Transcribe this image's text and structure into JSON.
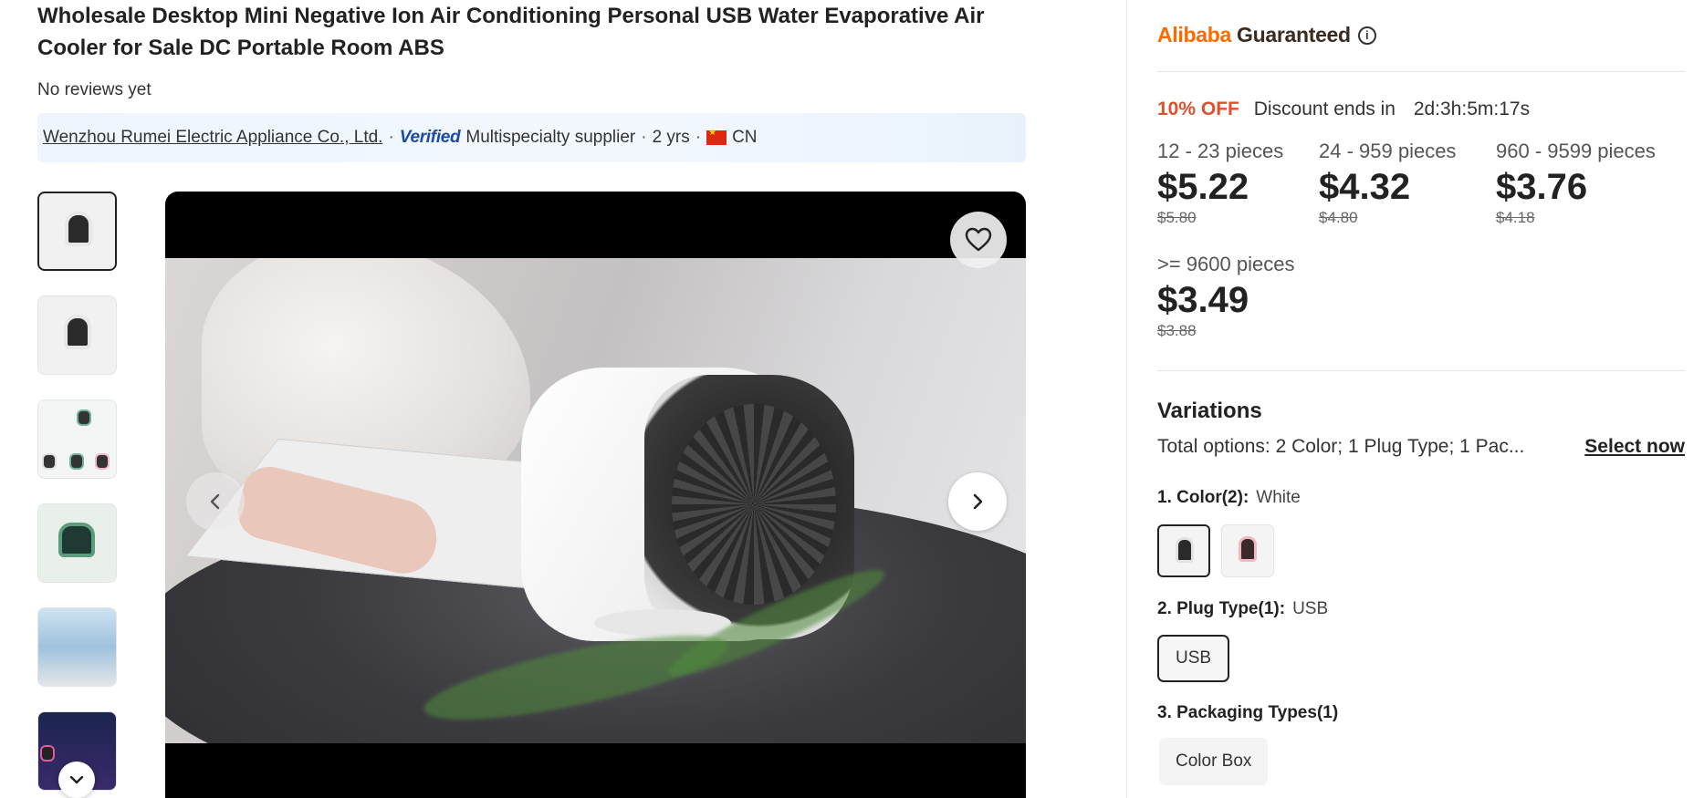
{
  "product": {
    "title": "Wholesale Desktop Mini Negative Ion Air Conditioning Personal USB Water Evaporative Air Cooler for Sale DC Portable Room ABS",
    "reviews": "No reviews yet"
  },
  "supplier": {
    "name": "Wenzhou Rumei Electric Appliance Co., Ltd.",
    "sep1": "·",
    "verified_label": "Verified",
    "type": "Multispecialty supplier",
    "sep2": "·",
    "years": "2 yrs",
    "sep3": "·",
    "country": "CN",
    "country_flag": "china-flag-icon"
  },
  "gallery": {
    "thumbnails": [
      {
        "name": "thumbnail-1",
        "kind": "white-fan",
        "selected": true
      },
      {
        "name": "thumbnail-2",
        "kind": "white-fan"
      },
      {
        "name": "thumbnail-3",
        "kind": "multi-color"
      },
      {
        "name": "thumbnail-4",
        "kind": "green-fan"
      },
      {
        "name": "thumbnail-5",
        "kind": "poster"
      },
      {
        "name": "thumbnail-6",
        "kind": "dark-poster"
      }
    ],
    "icons": {
      "favorite": "heart-icon",
      "prev": "chevron-left-icon",
      "next": "chevron-right-icon",
      "more": "chevron-down-icon"
    }
  },
  "guarantee": {
    "brand": "Alibaba",
    "label": "Guaranteed",
    "info_icon": "ⓘ",
    "brand_color": "#ff6a00"
  },
  "discount": {
    "percent": "10% OFF",
    "label": "Discount ends in",
    "countdown": "2d:3h:5m:17s",
    "color": "#e0502b"
  },
  "price_tiers": [
    {
      "range": "12 - 23 pieces",
      "price": "$5.22",
      "original": "$5.80"
    },
    {
      "range": "24 - 959 pieces",
      "price": "$4.32",
      "original": "$4.80"
    },
    {
      "range": "960 - 9599 pieces",
      "price": "$3.76",
      "original": "$4.18"
    },
    {
      "range": ">= 9600 pieces",
      "price": "$3.49",
      "original": "$3.88"
    }
  ],
  "variations": {
    "title": "Variations",
    "summary": "Total options: 2 Color; 1 Plug Type; 1 Pac...",
    "select_now": "Select now",
    "color": {
      "label": "1. Color(2):",
      "value": "White"
    },
    "plug": {
      "label": "2. Plug Type(1):",
      "value": "USB",
      "option": "USB"
    },
    "packaging": {
      "label": "3. Packaging Types(1)",
      "option": "Color Box"
    }
  }
}
